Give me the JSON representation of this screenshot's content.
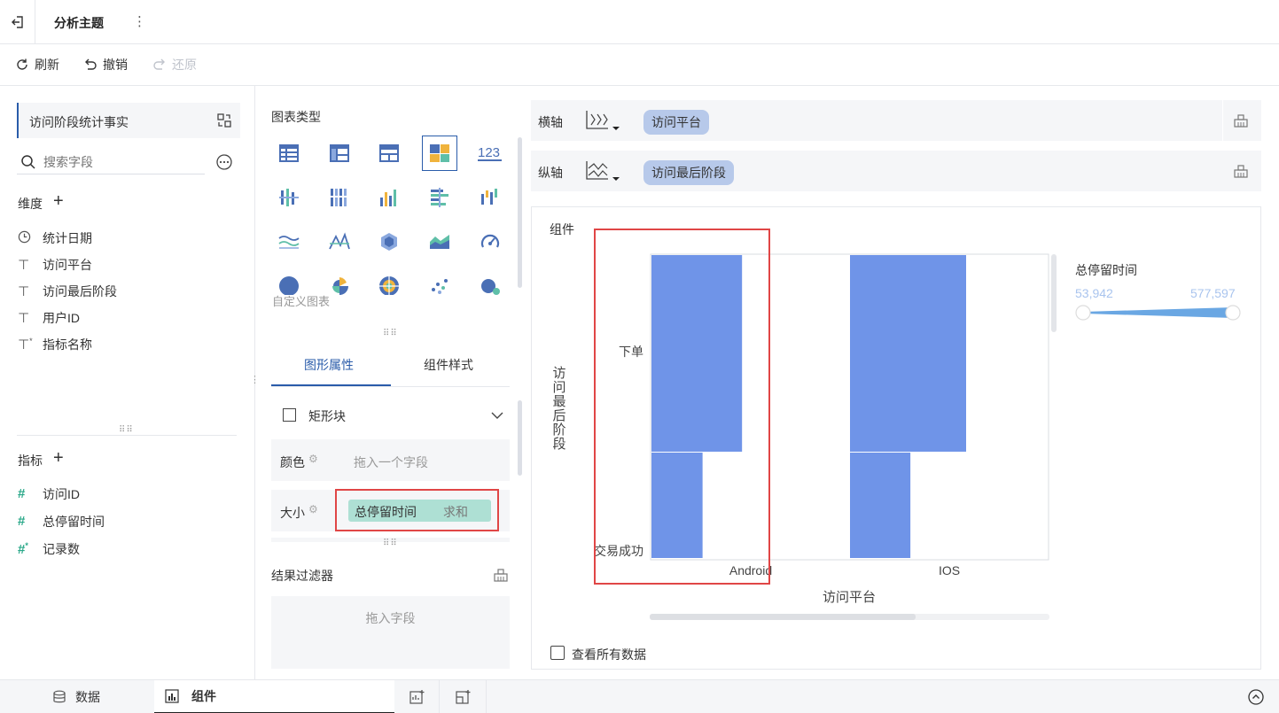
{
  "topbar": {
    "title": "分析主题",
    "more": "⋮"
  },
  "toolbar": {
    "refresh": "刷新",
    "undo": "撤销",
    "redo": "还原"
  },
  "left": {
    "table_name": "访问阶段统计事实",
    "search_placeholder": "搜索字段",
    "dimensions_title": "维度",
    "dimensions": [
      {
        "icon": "clock-icon",
        "label": "统计日期"
      },
      {
        "icon": "text-type-icon",
        "label": "访问平台"
      },
      {
        "icon": "text-type-icon",
        "label": "访问最后阶段"
      },
      {
        "icon": "text-type-icon",
        "label": "用户ID"
      },
      {
        "icon": "text-calc-icon",
        "label": "指标名称"
      }
    ],
    "metrics_title": "指标",
    "metrics": [
      {
        "icon": "number-type-icon",
        "label": "访问ID"
      },
      {
        "icon": "number-type-icon",
        "label": "总停留时间"
      },
      {
        "icon": "number-calc-icon",
        "label": "记录数"
      }
    ]
  },
  "mid": {
    "chart_type_title": "图表类型",
    "custom_chart": "自定义图表",
    "tab_graphic": "图形属性",
    "tab_style": "组件样式",
    "mark_type": "矩形块",
    "color_label": "颜色",
    "color_placeholder": "拖入一个字段",
    "size_label": "大小",
    "size_field": "总停留时间",
    "size_agg": "求和",
    "filter_title": "结果过滤器",
    "filter_placeholder": "拖入字段"
  },
  "right": {
    "x_axis_label": "横轴",
    "x_axis_field": "访问平台",
    "y_axis_label": "纵轴",
    "y_axis_field": "访问最后阶段",
    "component_title": "组件",
    "legend_title": "总停留时间",
    "legend_min": "53,942",
    "legend_max": "577,597",
    "view_all": "查看所有数据"
  },
  "chart_data": {
    "type": "heatmap",
    "xlabel": "访问平台",
    "ylabel": "访问最后阶段",
    "categories": [
      "Android",
      "IOS"
    ],
    "y_categories": [
      "下单",
      "交易成功"
    ],
    "size_field": "总停留时间",
    "cells": [
      {
        "x": "Android",
        "y": "下单",
        "width_fraction": 0.78,
        "height_fraction": 0.65
      },
      {
        "x": "Android",
        "y": "交易成功",
        "width_fraction": 0.44,
        "height_fraction": 0.35
      },
      {
        "x": "IOS",
        "y": "下单",
        "width_fraction": 1.0,
        "height_fraction": 0.65
      },
      {
        "x": "IOS",
        "y": "交易成功",
        "width_fraction": 0.52,
        "height_fraction": 0.35
      }
    ],
    "color": "#6f94e8"
  },
  "bottom": {
    "tab_data": "数据",
    "tab_component": "组件"
  },
  "colors": {
    "accent": "#2a5caa",
    "highlight_box": "#e04646",
    "bar": "#6f94e8",
    "pill_green": "#aee0d4",
    "pill_blue": "#b7c9ea"
  }
}
